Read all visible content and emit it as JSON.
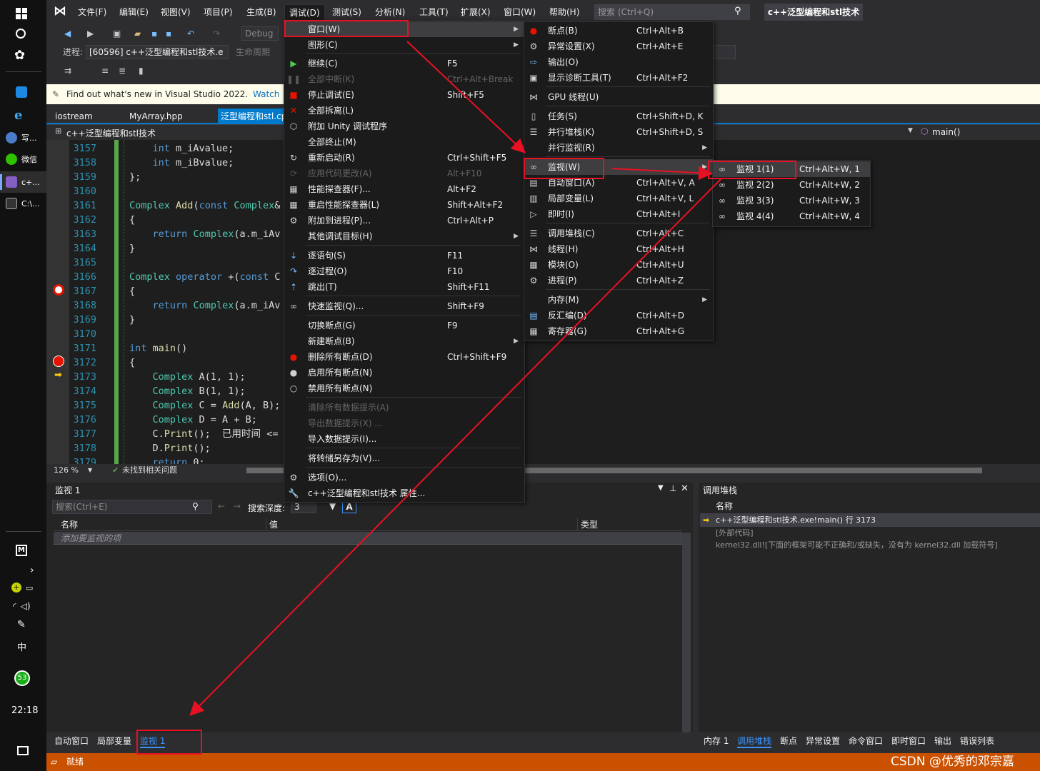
{
  "taskbar": {
    "items": [
      {
        "label": "写..."
      },
      {
        "label": "微信"
      },
      {
        "label": "c+..."
      },
      {
        "label": "C:\\..."
      }
    ],
    "ime": "中",
    "badge": "53",
    "clock": "22:18"
  },
  "menubar": {
    "items": [
      "文件(F)",
      "编辑(E)",
      "视图(V)",
      "项目(P)",
      "生成(B)",
      "调试(D)",
      "测试(S)",
      "分析(N)",
      "工具(T)",
      "扩展(X)",
      "窗口(W)",
      "帮助(H)"
    ],
    "search_placeholder": "搜索 (Ctrl+Q)",
    "solution_title": "c++泛型编程和stl技术"
  },
  "toolbar": {
    "config": "Debug",
    "process_label": "进程:",
    "process_value": "[60596] c++泛型编程和stl技术.e",
    "lifecycle": "生命周期"
  },
  "infobar": {
    "message": "Find out what's new in Visual Studio 2022.",
    "link": "Watch"
  },
  "tabs": [
    "iostream",
    "MyArray.hpp",
    "泛型编程和stl.cp"
  ],
  "navbar": {
    "scope": "c++泛型编程和stl技术",
    "function": "main()"
  },
  "editor": {
    "lines": [
      {
        "n": "3157",
        "code": "    int m_iAvalue;"
      },
      {
        "n": "3158",
        "code": "    int m_iBvalue;"
      },
      {
        "n": "3159",
        "code": "};"
      },
      {
        "n": "3160",
        "code": ""
      },
      {
        "n": "3161",
        "code": "Complex Add(const Complex&"
      },
      {
        "n": "3162",
        "code": "{"
      },
      {
        "n": "3163",
        "code": "    return Complex(a.m_iAv"
      },
      {
        "n": "3164",
        "code": "}"
      },
      {
        "n": "3165",
        "code": ""
      },
      {
        "n": "3166",
        "code": "Complex operator +(const C"
      },
      {
        "n": "3167",
        "code": "{"
      },
      {
        "n": "3168",
        "code": "    return Complex(a.m_iAv"
      },
      {
        "n": "3169",
        "code": "}"
      },
      {
        "n": "3170",
        "code": ""
      },
      {
        "n": "3171",
        "code": "int main()"
      },
      {
        "n": "3172",
        "code": "{"
      },
      {
        "n": "3173",
        "code": "    Complex A(1, 1);"
      },
      {
        "n": "3174",
        "code": "    Complex B(1, 1);"
      },
      {
        "n": "3175",
        "code": "    Complex C = Add(A, B);"
      },
      {
        "n": "3176",
        "code": "    Complex D = A + B;"
      },
      {
        "n": "3177",
        "code": "    C.Print();  已用时间 <= 1"
      },
      {
        "n": "3178",
        "code": "    D.Print();"
      },
      {
        "n": "3179",
        "code": "    return 0;"
      }
    ],
    "zoom": "126 %",
    "issues": "未找到相关问题"
  },
  "debug_menu": {
    "items": [
      {
        "label": "窗口(W)",
        "shortcut": "",
        "submenu": true
      },
      {
        "label": "图形(C)",
        "shortcut": "",
        "submenu": true
      },
      {
        "label": "继续(C)",
        "shortcut": "F5"
      },
      {
        "label": "全部中断(K)",
        "shortcut": "Ctrl+Alt+Break",
        "disabled": true
      },
      {
        "label": "停止调试(E)",
        "shortcut": "Shift+F5"
      },
      {
        "label": "全部拆离(L)",
        "shortcut": ""
      },
      {
        "label": "附加 Unity 调试程序",
        "shortcut": ""
      },
      {
        "label": "全部终止(M)",
        "shortcut": ""
      },
      {
        "label": "重新启动(R)",
        "shortcut": "Ctrl+Shift+F5"
      },
      {
        "label": "应用代码更改(A)",
        "shortcut": "Alt+F10",
        "disabled": true
      },
      {
        "label": "性能探查器(F)...",
        "shortcut": "Alt+F2"
      },
      {
        "label": "重启性能探查器(L)",
        "shortcut": "Shift+Alt+F2"
      },
      {
        "label": "附加到进程(P)...",
        "shortcut": "Ctrl+Alt+P"
      },
      {
        "label": "其他调试目标(H)",
        "shortcut": "",
        "submenu": true
      },
      {
        "label": "逐语句(S)",
        "shortcut": "F11"
      },
      {
        "label": "逐过程(O)",
        "shortcut": "F10"
      },
      {
        "label": "跳出(T)",
        "shortcut": "Shift+F11"
      },
      {
        "label": "快速监视(Q)...",
        "shortcut": "Shift+F9"
      },
      {
        "label": "切换断点(G)",
        "shortcut": "F9"
      },
      {
        "label": "新建断点(B)",
        "shortcut": "",
        "submenu": true
      },
      {
        "label": "删除所有断点(D)",
        "shortcut": "Ctrl+Shift+F9"
      },
      {
        "label": "启用所有断点(N)",
        "shortcut": ""
      },
      {
        "label": "禁用所有断点(N)",
        "shortcut": ""
      },
      {
        "label": "清除所有数据提示(A)",
        "shortcut": "",
        "disabled": true
      },
      {
        "label": "导出数据提示(X) ...",
        "shortcut": "",
        "disabled": true
      },
      {
        "label": "导入数据提示(I)...",
        "shortcut": ""
      },
      {
        "label": "将转储另存为(V)...",
        "shortcut": ""
      },
      {
        "label": "选项(O)...",
        "shortcut": ""
      },
      {
        "label": "c++泛型编程和stl技术 属性...",
        "shortcut": ""
      }
    ]
  },
  "window_menu": {
    "items": [
      {
        "label": "断点(B)",
        "shortcut": "Ctrl+Alt+B"
      },
      {
        "label": "异常设置(X)",
        "shortcut": "Ctrl+Alt+E"
      },
      {
        "label": "输出(O)",
        "shortcut": ""
      },
      {
        "label": "显示诊断工具(T)",
        "shortcut": "Ctrl+Alt+F2"
      },
      {
        "label": "GPU 线程(U)",
        "shortcut": ""
      },
      {
        "label": "任务(S)",
        "shortcut": "Ctrl+Shift+D, K"
      },
      {
        "label": "并行堆栈(K)",
        "shortcut": "Ctrl+Shift+D, S"
      },
      {
        "label": "并行监视(R)",
        "shortcut": "",
        "submenu": true
      },
      {
        "label": "监视(W)",
        "shortcut": "",
        "submenu": true
      },
      {
        "label": "自动窗口(A)",
        "shortcut": "Ctrl+Alt+V, A"
      },
      {
        "label": "局部变量(L)",
        "shortcut": "Ctrl+Alt+V, L"
      },
      {
        "label": "即时(I)",
        "shortcut": "Ctrl+Alt+I"
      },
      {
        "label": "调用堆栈(C)",
        "shortcut": "Ctrl+Alt+C"
      },
      {
        "label": "线程(H)",
        "shortcut": "Ctrl+Alt+H"
      },
      {
        "label": "模块(O)",
        "shortcut": "Ctrl+Alt+U"
      },
      {
        "label": "进程(P)",
        "shortcut": "Ctrl+Alt+Z"
      },
      {
        "label": "内存(M)",
        "shortcut": "",
        "submenu": true
      },
      {
        "label": "反汇编(D)",
        "shortcut": "Ctrl+Alt+D"
      },
      {
        "label": "寄存器(G)",
        "shortcut": "Ctrl+Alt+G"
      }
    ]
  },
  "watch_menu": {
    "items": [
      {
        "label": "监视 1(1)",
        "shortcut": "Ctrl+Alt+W, 1"
      },
      {
        "label": "监视 2(2)",
        "shortcut": "Ctrl+Alt+W, 2"
      },
      {
        "label": "监视 3(3)",
        "shortcut": "Ctrl+Alt+W, 3"
      },
      {
        "label": "监视 4(4)",
        "shortcut": "Ctrl+Alt+W, 4"
      }
    ]
  },
  "watch_panel": {
    "title": "监视 1",
    "search_placeholder": "搜索(Ctrl+E)",
    "depth_label": "搜索深度:",
    "depth_value": "3",
    "columns": [
      "名称",
      "值",
      "类型"
    ],
    "add_item": "添加要监视的项"
  },
  "callstack_panel": {
    "title": "调用堆栈",
    "column": "名称",
    "rows": [
      "c++泛型编程和stl技术.exe!main() 行 3173",
      "[外部代码]",
      "kernel32.dll![下面的框架可能不正确和/或缺失，没有为 kernel32.dll 加载符号]"
    ]
  },
  "bottom_tabs_left": [
    "自动窗口",
    "局部变量",
    "监视 1"
  ],
  "bottom_tabs_right": [
    "内存 1",
    "调用堆栈",
    "断点",
    "异常设置",
    "命令窗口",
    "即时窗口",
    "输出",
    "错误列表"
  ],
  "statusbar": {
    "text": "就绪"
  },
  "watermark": "CSDN @优秀的邓宗嘉"
}
